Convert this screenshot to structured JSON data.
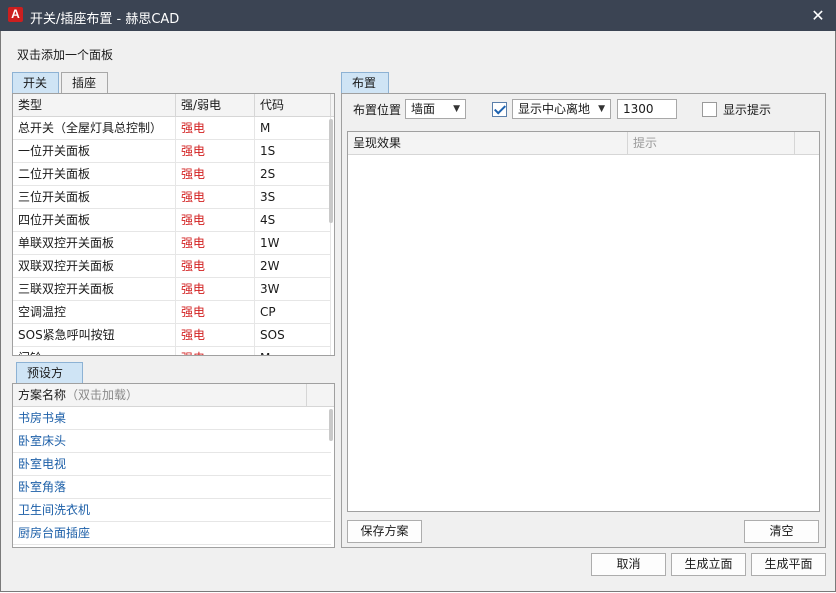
{
  "window": {
    "title": "开关/插座布置 - 赫思CAD",
    "logo_letter": "A",
    "close_glyph": "✕"
  },
  "hint": "双击添加一个面板",
  "left_tabs": [
    {
      "label": "开关",
      "active": true
    },
    {
      "label": "插座",
      "active": false
    }
  ],
  "panel_table": {
    "headers": [
      "类型",
      "强/弱电",
      "代码"
    ],
    "rows": [
      {
        "type": "总开关（全屋灯具总控制）",
        "power": "强电",
        "code": "M"
      },
      {
        "type": "一位开关面板",
        "power": "强电",
        "code": "1S"
      },
      {
        "type": "二位开关面板",
        "power": "强电",
        "code": "2S"
      },
      {
        "type": "三位开关面板",
        "power": "强电",
        "code": "3S"
      },
      {
        "type": "四位开关面板",
        "power": "强电",
        "code": "4S"
      },
      {
        "type": "单联双控开关面板",
        "power": "强电",
        "code": "1W"
      },
      {
        "type": "双联双控开关面板",
        "power": "强电",
        "code": "2W"
      },
      {
        "type": "三联双控开关面板",
        "power": "强电",
        "code": "3W"
      },
      {
        "type": "空调温控",
        "power": "强电",
        "code": "CP"
      },
      {
        "type": "SOS紧急呼叫按钮",
        "power": "强电",
        "code": "SOS"
      },
      {
        "type": "门铃",
        "power": "强电",
        "code": "M"
      }
    ]
  },
  "preset_tab": "预设方案",
  "preset_table": {
    "header": "方案名称",
    "header_hint": "（双击加载）",
    "rows": [
      "书房书桌",
      "卧室床头",
      "卧室电视",
      "卧室角落",
      "卫生间洗衣机",
      "厨房台面插座"
    ]
  },
  "right_tab": "布置",
  "layout": {
    "position_label": "布置位置",
    "position_value": "墙面",
    "center_checkbox_checked": true,
    "center_option": "显示中心离地",
    "height_value": "1300",
    "show_tip_checked": false,
    "show_tip_label": "显示提示"
  },
  "result_table": {
    "headers": [
      "呈现效果",
      "提示"
    ]
  },
  "buttons": {
    "save_scheme": "保存方案",
    "clear": "清空",
    "cancel": "取消",
    "gen_elevation": "生成立面",
    "gen_plan": "生成平面"
  },
  "colors": {
    "titlebar": "#3b4453",
    "strong_power": "#d21f1f",
    "preset_link": "#1c5fa8",
    "active_tab": "#cfe4f5"
  },
  "icons": {
    "close": "close-icon",
    "dropdown": "chevron-down-icon",
    "logo": "app-logo-icon"
  }
}
